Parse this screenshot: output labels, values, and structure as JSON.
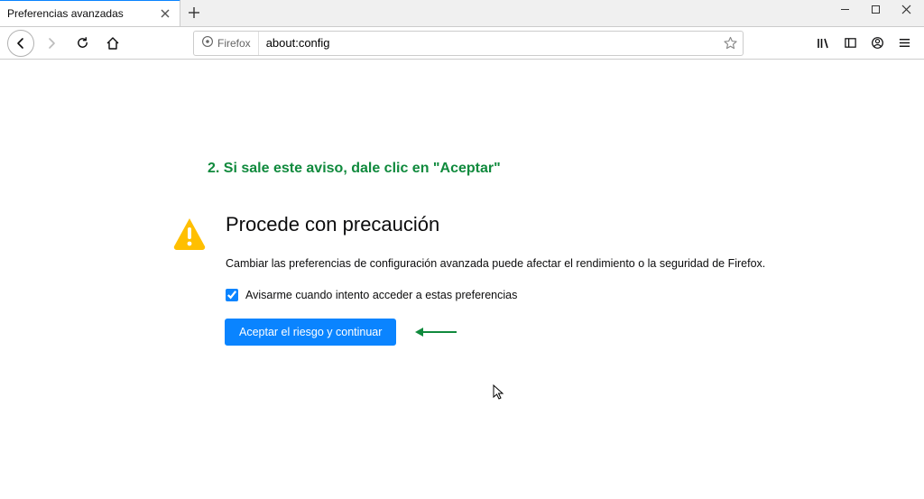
{
  "tab": {
    "title": "Preferencias avanzadas"
  },
  "urlbar": {
    "identity_label": "Firefox",
    "url": "about:config"
  },
  "annotation": {
    "instruction": "2. Si sale este aviso, dale clic en \"Aceptar\""
  },
  "warning": {
    "title": "Procede con precaución",
    "body": "Cambiar las preferencias de configuración avanzada puede afectar el rendimiento o la seguridad de Firefox.",
    "checkbox_label": "Avisarme cuando intento acceder a estas preferencias",
    "accept_label": "Aceptar el riesgo y continuar"
  },
  "colors": {
    "accent": "#0a84ff",
    "annotation_green": "#108a3d",
    "warning_yellow": "#ffbf00"
  }
}
